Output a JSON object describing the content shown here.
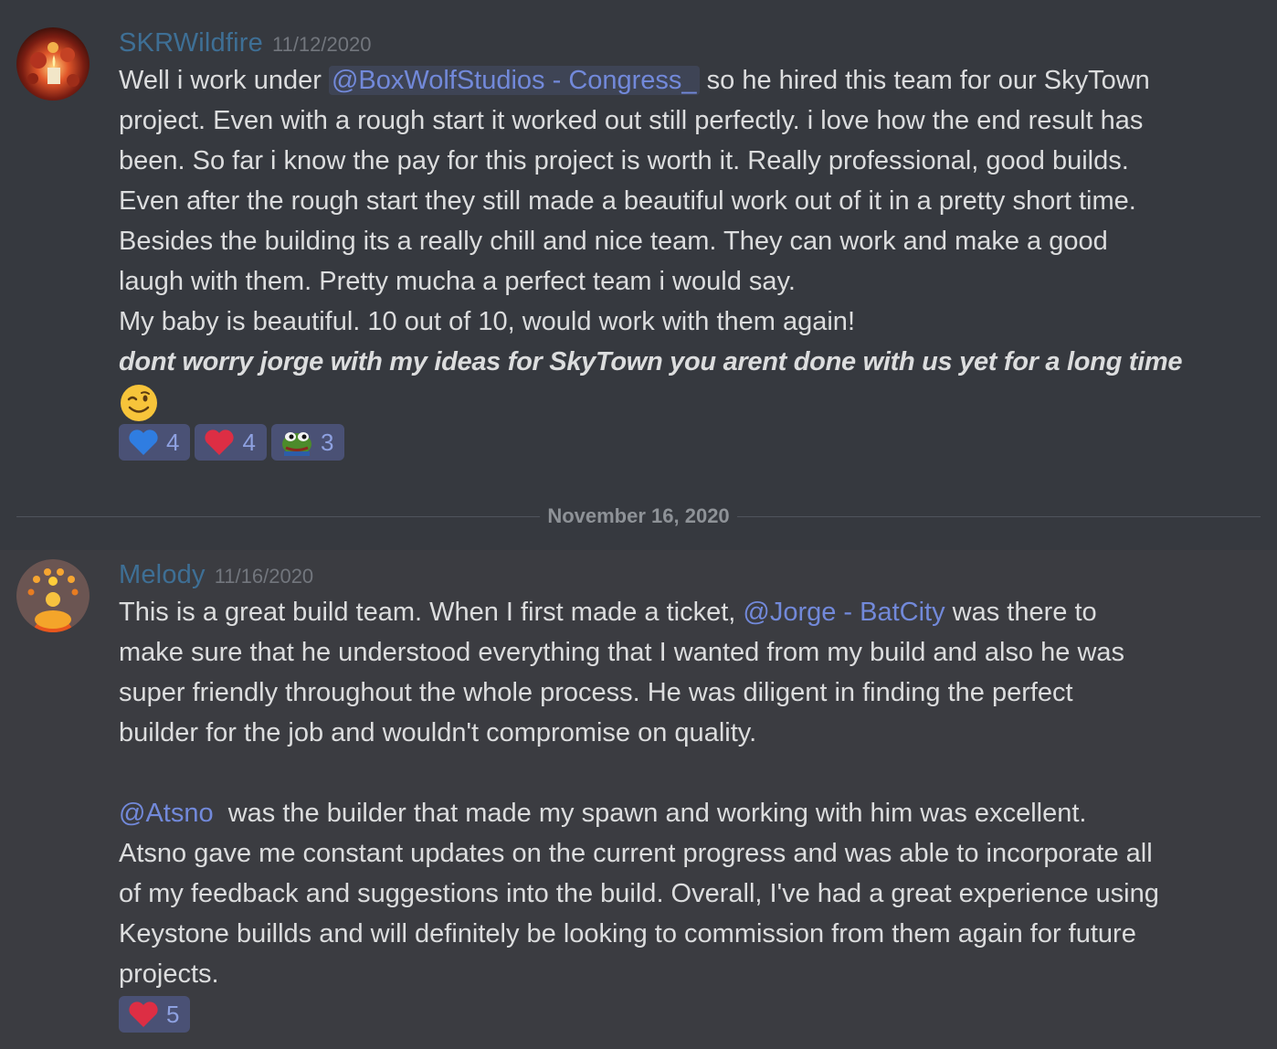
{
  "messages": [
    {
      "username": "SKRWildfire",
      "timestamp": "11/12/2020",
      "line1_pre": "Well i work under ",
      "line1_mention": "@BoxWolfStudios - Congress_",
      "line1_post": " so he hired this team for our SkyTown",
      "lines": [
        "project. Even with a rough start it worked out still perfectly. i love how the end result has",
        "been. So far i know the pay for this project is worth it. Really professional, good builds.",
        "Even after the rough start they still made a beautiful work out of it in a pretty short time.",
        "Besides the building its a really chill and nice team. They can work and make a good",
        "laugh with them. Pretty mucha a perfect team i would say.",
        "My baby is beautiful. 10 out of 10, would work with them again!"
      ],
      "bold_line": "dont worry jorge with my ideas for SkyTown you arent done with us yet for a long time",
      "emoji": "wink-emoji",
      "reactions": [
        {
          "icon": "blue-heart-icon",
          "count": "4"
        },
        {
          "icon": "red-heart-icon",
          "count": "4"
        },
        {
          "icon": "pepe-frog-icon",
          "count": "3"
        }
      ]
    },
    {
      "username": "Melody",
      "timestamp": "11/16/2020",
      "p1_line1_pre": "This is a great build team. When I first made a ticket, ",
      "p1_line1_mention": "@Jorge - BatCity",
      "p1_line1_post": " was there to",
      "p1_lines": [
        "make sure that he understood everything that I wanted from my build and also he was",
        "super friendly throughout the whole process. He was diligent in finding the perfect",
        "builder for the job and wouldn't compromise on quality."
      ],
      "p2_line1_mention": "@Atsno",
      "p2_line1_post": "  was the builder that made my spawn and working with him was excellent.",
      "p2_lines": [
        "Atsno gave me constant updates on the current progress and was able to incorporate all",
        "of my feedback and suggestions into the build. Overall, I've had a great experience using",
        "Keystone buillds and will definitely be looking to commission from them again for future",
        "projects."
      ],
      "reactions": [
        {
          "icon": "red-heart-icon",
          "count": "5"
        }
      ]
    }
  ],
  "date_divider": "November 16, 2020",
  "colors": {
    "background": "#36393f",
    "username": "#3e6f95",
    "mention": "#7289da",
    "reaction_bg": "#4a5175"
  }
}
